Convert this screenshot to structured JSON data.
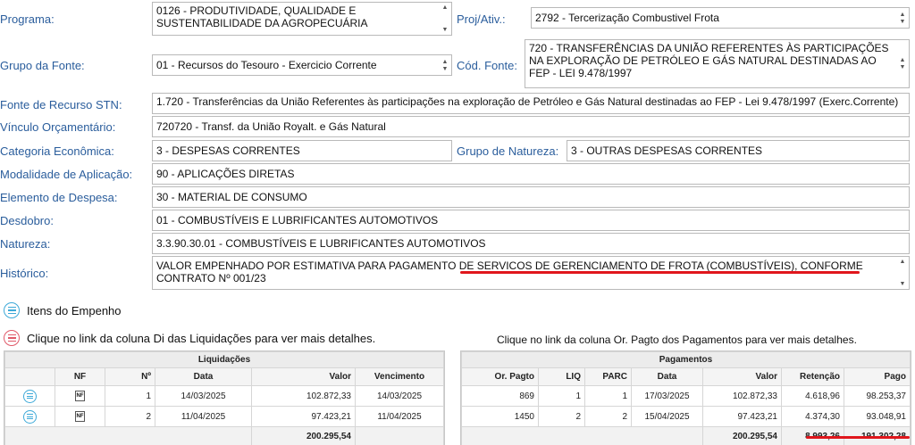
{
  "form": {
    "programa": {
      "label": "Programa:",
      "value": "0126 - PRODUTIVIDADE, QUALIDADE E SUSTENTABILIDADE DA AGROPECUÁRIA"
    },
    "proj_ativ": {
      "label": "Proj/Ativ.:",
      "value": "2792 - Tercerização Combustivel Frota"
    },
    "grupo_fonte": {
      "label": "Grupo da Fonte:",
      "value": "01 - Recursos do Tesouro - Exercicio Corrente"
    },
    "cod_fonte": {
      "label": "Cód. Fonte:",
      "value": "720 - TRANSFERÊNCIAS DA UNIÃO REFERENTES ÀS PARTICIPAÇÕES NA EXPLORAÇÃO DE PETRÓLEO E GÁS NATURAL DESTINADAS AO FEP - LEI 9.478/1997"
    },
    "fonte_stn": {
      "label": "Fonte de Recurso STN:",
      "value": "1.720 - Transferências da União Referentes às participações na exploração de Petróleo e Gás Natural destinadas ao FEP - Lei 9.478/1997 (Exerc.Corrente)"
    },
    "vinculo": {
      "label": "Vínculo Orçamentário:",
      "value": "720720 - Transf. da União Royalt. e Gás Natural"
    },
    "categoria": {
      "label": "Categoria Econômica:",
      "value": "3 - DESPESAS CORRENTES"
    },
    "grupo_natureza": {
      "label": "Grupo de Natureza:",
      "value": "3 - OUTRAS DESPESAS CORRENTES"
    },
    "modalidade": {
      "label": "Modalidade de Aplicação:",
      "value": "90 - APLICAÇÕES DIRETAS"
    },
    "elemento": {
      "label": "Elemento de Despesa:",
      "value": "30 - MATERIAL DE CONSUMO"
    },
    "desdobro": {
      "label": "Desdobro:",
      "value": "01 - COMBUSTÍVEIS E LUBRIFICANTES AUTOMOTIVOS"
    },
    "natureza": {
      "label": "Natureza:",
      "value": "3.3.90.30.01 - COMBUSTÍVEIS E LUBRIFICANTES AUTOMOTIVOS"
    },
    "historico": {
      "label": "Histórico:",
      "value": "VALOR EMPENHADO POR ESTIMATIVA PARA PAGAMENTO DE SERVICOS DE GERENCIAMENTO DE FROTA (COMBUSTÍVEIS), CONFORME CONTRATO Nº 001/23"
    }
  },
  "sections": {
    "itens": "Itens do Empenho",
    "hint_liq": "Clique no link da coluna Di das Liquidações para ver mais detalhes.",
    "hint_pag": "Clique no link da coluna Or. Pagto dos Pagamentos para ver mais detalhes."
  },
  "liquidacoes": {
    "title": "Liquidações",
    "headers": {
      "nf": "NF",
      "n": "Nº",
      "data": "Data",
      "valor": "Valor",
      "vencimento": "Vencimento"
    },
    "rows": [
      {
        "n": "1",
        "data": "14/03/2025",
        "valor": "102.872,33",
        "vencimento": "14/03/2025"
      },
      {
        "n": "2",
        "data": "11/04/2025",
        "valor": "97.423,21",
        "vencimento": "11/04/2025"
      }
    ],
    "total": "200.295,54"
  },
  "pagamentos": {
    "title": "Pagamentos",
    "headers": {
      "or_pagto": "Or. Pagto",
      "liq": "LIQ",
      "parc": "PARC",
      "data": "Data",
      "valor": "Valor",
      "retencao": "Retenção",
      "pago": "Pago"
    },
    "rows": [
      {
        "or_pagto": "869",
        "liq": "1",
        "parc": "1",
        "data": "17/03/2025",
        "valor": "102.872,33",
        "retencao": "4.618,96",
        "pago": "98.253,37"
      },
      {
        "or_pagto": "1450",
        "liq": "2",
        "parc": "2",
        "data": "15/04/2025",
        "valor": "97.423,21",
        "retencao": "4.374,30",
        "pago": "93.048,91"
      }
    ],
    "total_valor": "200.295,54",
    "total_retencao": "8.993,26",
    "total_pago": "191.302,28"
  },
  "colors": {
    "label": "#2a5d9c",
    "annotation": "#e0161c",
    "icon_blue": "#3da9d8",
    "icon_red": "#e05a6a"
  },
  "icons": {
    "section_itens": "list-icon",
    "section_hint": "list-icon-red",
    "row_detail": "list-icon",
    "nf": "nf-document-icon"
  }
}
